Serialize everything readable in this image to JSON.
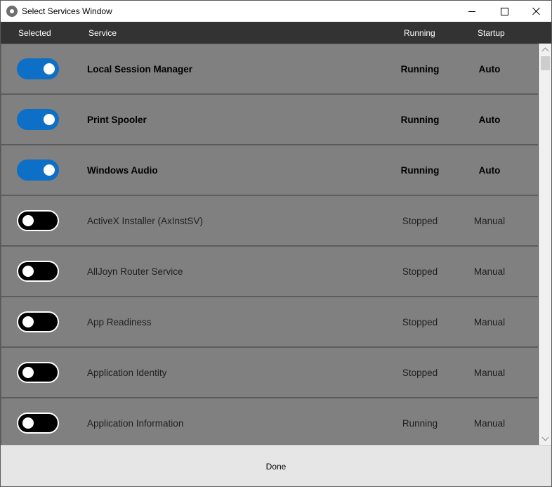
{
  "window": {
    "title": "Select Services Window",
    "icon": "gear-icon"
  },
  "columns": {
    "selected": "Selected",
    "service": "Service",
    "running": "Running",
    "startup": "Startup"
  },
  "colors": {
    "toggle_on": "#0e6fc6",
    "toggle_off": "#000000",
    "header_bg": "#333333",
    "list_bg": "#808080"
  },
  "services": [
    {
      "selected": true,
      "name": "Local Session Manager",
      "running": "Running",
      "startup": "Auto"
    },
    {
      "selected": true,
      "name": "Print Spooler",
      "running": "Running",
      "startup": "Auto"
    },
    {
      "selected": true,
      "name": "Windows Audio",
      "running": "Running",
      "startup": "Auto"
    },
    {
      "selected": false,
      "name": "ActiveX Installer (AxInstSV)",
      "running": "Stopped",
      "startup": "Manual"
    },
    {
      "selected": false,
      "name": "AllJoyn Router Service",
      "running": "Stopped",
      "startup": "Manual"
    },
    {
      "selected": false,
      "name": "App Readiness",
      "running": "Stopped",
      "startup": "Manual"
    },
    {
      "selected": false,
      "name": "Application Identity",
      "running": "Stopped",
      "startup": "Manual"
    },
    {
      "selected": false,
      "name": "Application Information",
      "running": "Running",
      "startup": "Manual"
    }
  ],
  "footer": {
    "done_label": "Done"
  }
}
